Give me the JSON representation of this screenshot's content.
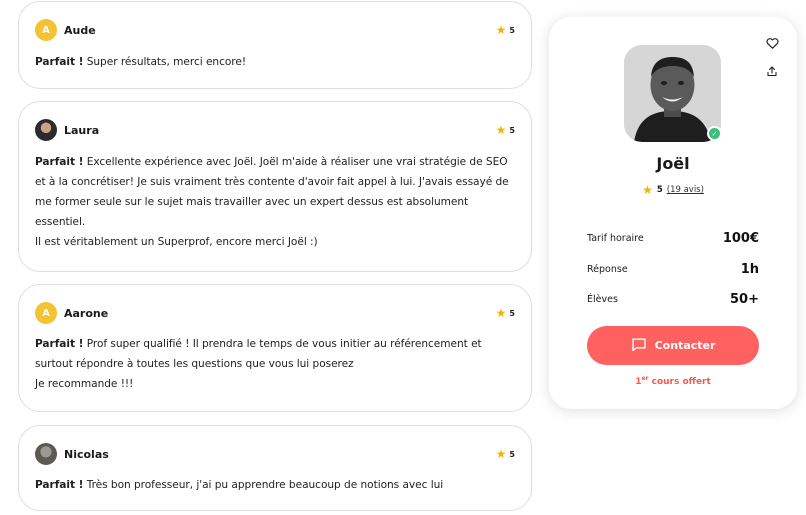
{
  "reviews": [
    {
      "author": "Aude",
      "avatar_letter": "A",
      "rating": "5",
      "lead": "Parfait !",
      "lines": [
        "Super résultats, merci encore!"
      ]
    },
    {
      "author": "Laura",
      "avatar_letter": "",
      "rating": "5",
      "lead": "Parfait !",
      "lines": [
        "Excellente expérience avec Joël. Joël m'aide à réaliser une vrai stratégie de SEO",
        "et à la concrétiser! Je suis vraiment très contente d'avoir fait appel à lui. J'avais essayé de",
        "me former seule sur le sujet mais travailler avec un expert dessus est absolument",
        "essentiel.",
        "Il est véritablement un Superprof, encore merci Joël :)"
      ]
    },
    {
      "author": "Aarone",
      "avatar_letter": "A",
      "rating": "5",
      "lead": "Parfait !",
      "lines": [
        "Prof super qualifié ! Il prendra le temps de vous initier au référencement et",
        "surtout répondre à toutes les questions que vous lui poserez",
        "Je recommande !!!"
      ]
    },
    {
      "author": "Nicolas",
      "avatar_letter": "",
      "rating": "5",
      "lead": "Parfait !",
      "lines": [
        "Très bon professeur, j'ai pu apprendre beaucoup de notions avec lui"
      ]
    }
  ],
  "profile": {
    "name": "Joël",
    "rating": "5",
    "reviews_count": "(19 avis)",
    "stats": [
      {
        "label": "Tarif horaire",
        "value": "100€"
      },
      {
        "label": "Réponse",
        "value": "1h"
      },
      {
        "label": "Élèves",
        "value": "50+"
      }
    ],
    "contact_label": "Contacter",
    "offer_prefix": "1",
    "offer_sup": "er",
    "offer_suffix": " cours offert"
  },
  "icons": {
    "favorite": "heart-icon",
    "share": "share-icon",
    "star": "star-icon",
    "message": "message-icon",
    "verified": "verified-badge-icon"
  },
  "colors": {
    "accent": "#ff6161",
    "star": "#f6b300",
    "avatar": "#f4c232",
    "verified": "#37c07a",
    "offer": "#ef5b4f"
  }
}
